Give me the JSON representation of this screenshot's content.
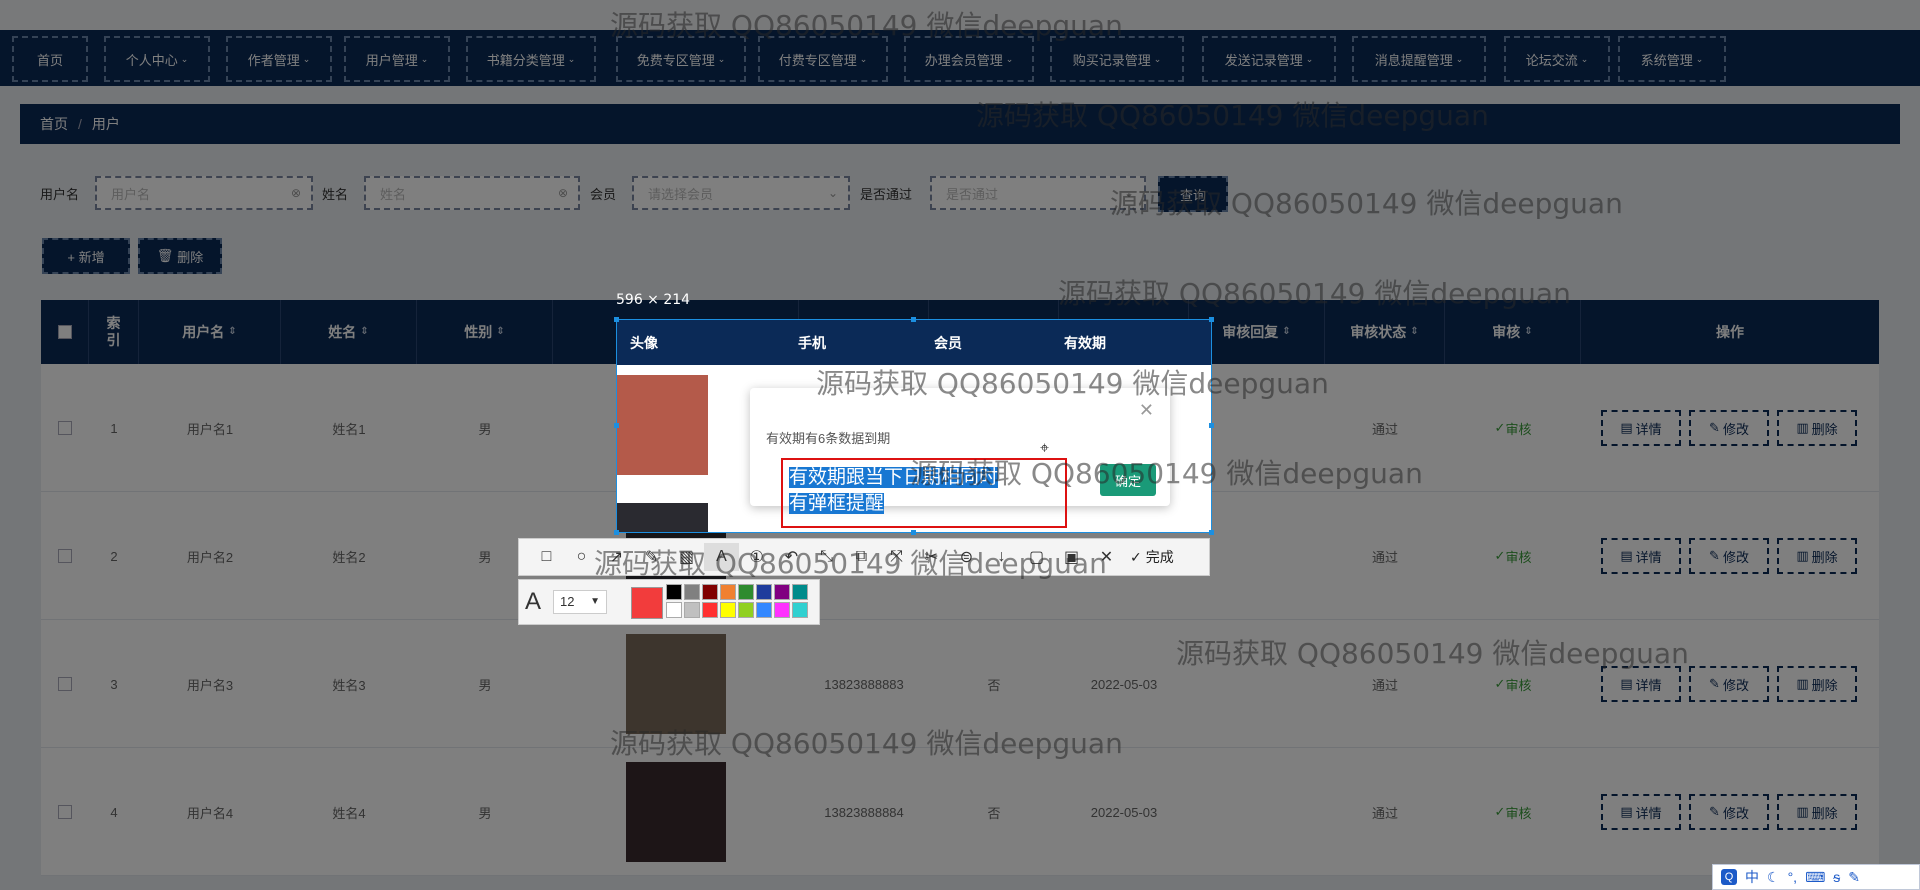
{
  "nav": [
    {
      "label": "首页"
    },
    {
      "label": "个人中心"
    },
    {
      "label": "作者管理"
    },
    {
      "label": "用户管理"
    },
    {
      "label": "书籍分类管理"
    },
    {
      "label": "免费专区管理"
    },
    {
      "label": "付费专区管理"
    },
    {
      "label": "办理会员管理"
    },
    {
      "label": "购买记录管理"
    },
    {
      "label": "发送记录管理"
    },
    {
      "label": "消息提醒管理"
    },
    {
      "label": "论坛交流"
    },
    {
      "label": "系统管理"
    }
  ],
  "breadcrumb": {
    "home": "首页",
    "sep": "/",
    "current": "用户"
  },
  "filters": {
    "username_label": "用户名",
    "username_placeholder": "用户名",
    "name_label": "姓名",
    "name_placeholder": "姓名",
    "member_label": "会员",
    "member_placeholder": "请选择会员",
    "approved_label": "是否通过",
    "approved_placeholder": "是否通过",
    "search_label": "查询"
  },
  "actions": {
    "add_label": "+ 新增",
    "delete_label": "删除"
  },
  "table": {
    "headers": {
      "index": "索引",
      "username": "用户名",
      "name": "姓名",
      "gender": "性别",
      "avatar": "头像",
      "phone": "手机",
      "member": "会员",
      "expiry": "有效期",
      "reply": "审核回复",
      "status": "审核状态",
      "review": "审核",
      "ops": "操作"
    },
    "rows": [
      {
        "index": "1",
        "username": "用户名1",
        "name": "姓名1",
        "gender": "男",
        "phone": "",
        "member": "",
        "expiry": "",
        "status": "通过",
        "review": "审核",
        "avatar_color": "#b45a4a"
      },
      {
        "index": "2",
        "username": "用户名2",
        "name": "姓名2",
        "gender": "男",
        "phone": "",
        "member": "",
        "expiry": "",
        "status": "通过",
        "review": "审核",
        "avatar_color": "#2a2a30"
      },
      {
        "index": "3",
        "username": "用户名3",
        "name": "姓名3",
        "gender": "男",
        "phone": "13823888883",
        "member": "否",
        "expiry": "2022-05-03",
        "status": "通过",
        "review": "审核",
        "avatar_color": "#7a6a5a"
      },
      {
        "index": "4",
        "username": "用户名4",
        "name": "姓名4",
        "gender": "男",
        "phone": "13823888884",
        "member": "否",
        "expiry": "2022-05-03",
        "status": "通过",
        "review": "审核",
        "avatar_color": "#3a2a2e"
      }
    ],
    "btn_detail": "详情",
    "btn_edit": "修改",
    "btn_delete": "删除"
  },
  "capture": {
    "size": "596 × 214",
    "done": "完成",
    "font_size": "12"
  },
  "alert": {
    "message": "有效期有6条数据到期",
    "ok": "确定"
  },
  "annotation": {
    "line1": "有效期跟当下日期相同时",
    "line2": "有弹框提醒"
  },
  "watermark": "源码获取 QQ86050149 微信deepguan",
  "palette": {
    "current": "#f23c3c",
    "top": [
      "#000000",
      "#808080",
      "#800000",
      "#f08030",
      "#2e8b2e",
      "#1f3c9c",
      "#800080",
      "#008b8b"
    ],
    "bottom": [
      "#ffffff",
      "#c0c0c0",
      "#ff3030",
      "#ffff00",
      "#90d020",
      "#3388ff",
      "#ff30ff",
      "#30d0d0"
    ]
  },
  "tray": {
    "ime": "中",
    "items": [
      "中",
      "☾",
      "°,",
      "⌨",
      "ᵴ",
      "✎"
    ]
  }
}
